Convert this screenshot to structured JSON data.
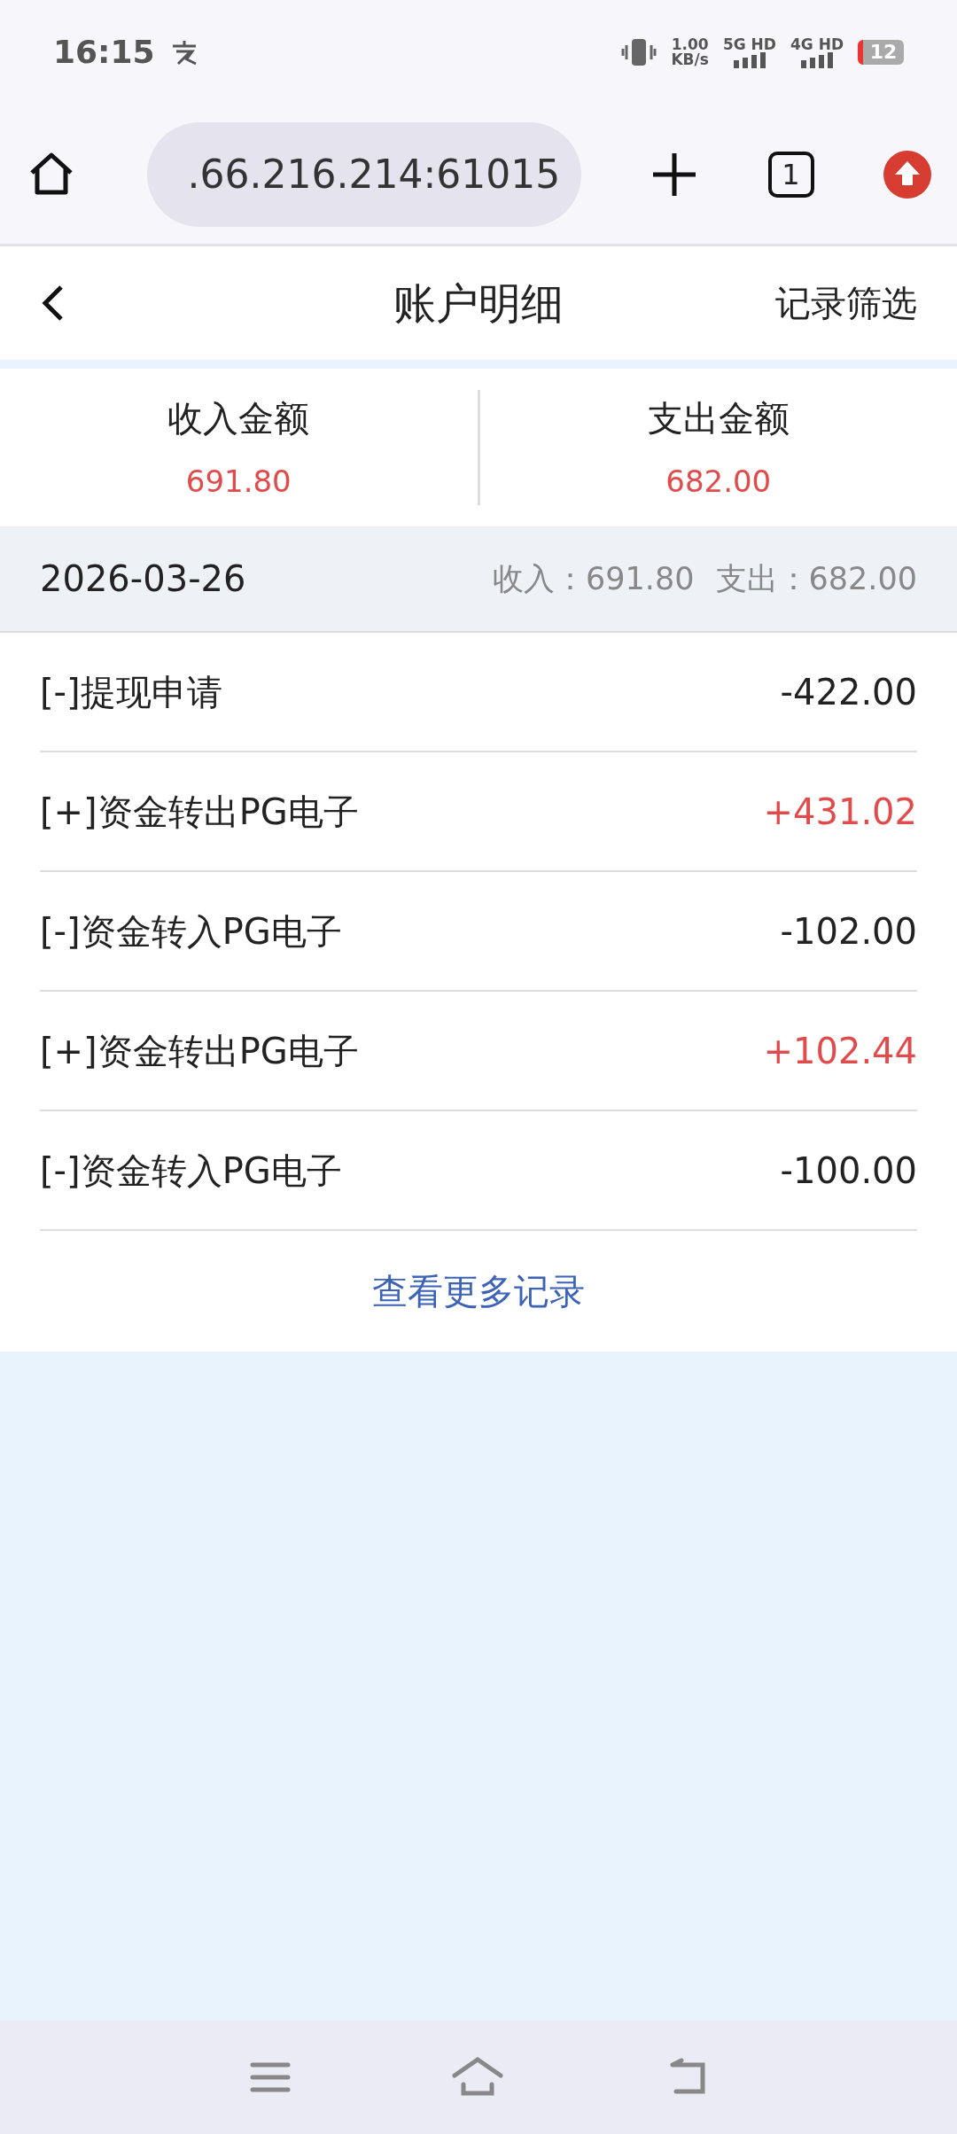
{
  "status_bar": {
    "time": "16:15",
    "net_speed": "1.00",
    "net_unit": "KB/s",
    "sim_1": "5G HD",
    "sim_2": "4G HD",
    "battery": "12"
  },
  "browser": {
    "url": ".66.216.214:61015",
    "tab_count": "1"
  },
  "header": {
    "title": "账户明细",
    "action": "记录筛选"
  },
  "summary": [
    {
      "label": "收入金额",
      "value": "691.80"
    },
    {
      "label": "支出金额",
      "value": "682.00"
    }
  ],
  "day": {
    "date": "2026-03-26",
    "income": "收入：691.80",
    "expense": "支出：682.00"
  },
  "records": [
    {
      "title": "[-]提现申请",
      "amount": "-422.00",
      "kind": "expense"
    },
    {
      "title": "[+]资金转出PG电子",
      "amount": "+431.02",
      "kind": "income"
    },
    {
      "title": "[-]资金转入PG电子",
      "amount": "-102.00",
      "kind": "expense"
    },
    {
      "title": "[+]资金转出PG电子",
      "amount": "+102.44",
      "kind": "income"
    },
    {
      "title": "[-]资金转入PG电子",
      "amount": "-100.00",
      "kind": "expense"
    }
  ],
  "more_link": "查看更多记录"
}
